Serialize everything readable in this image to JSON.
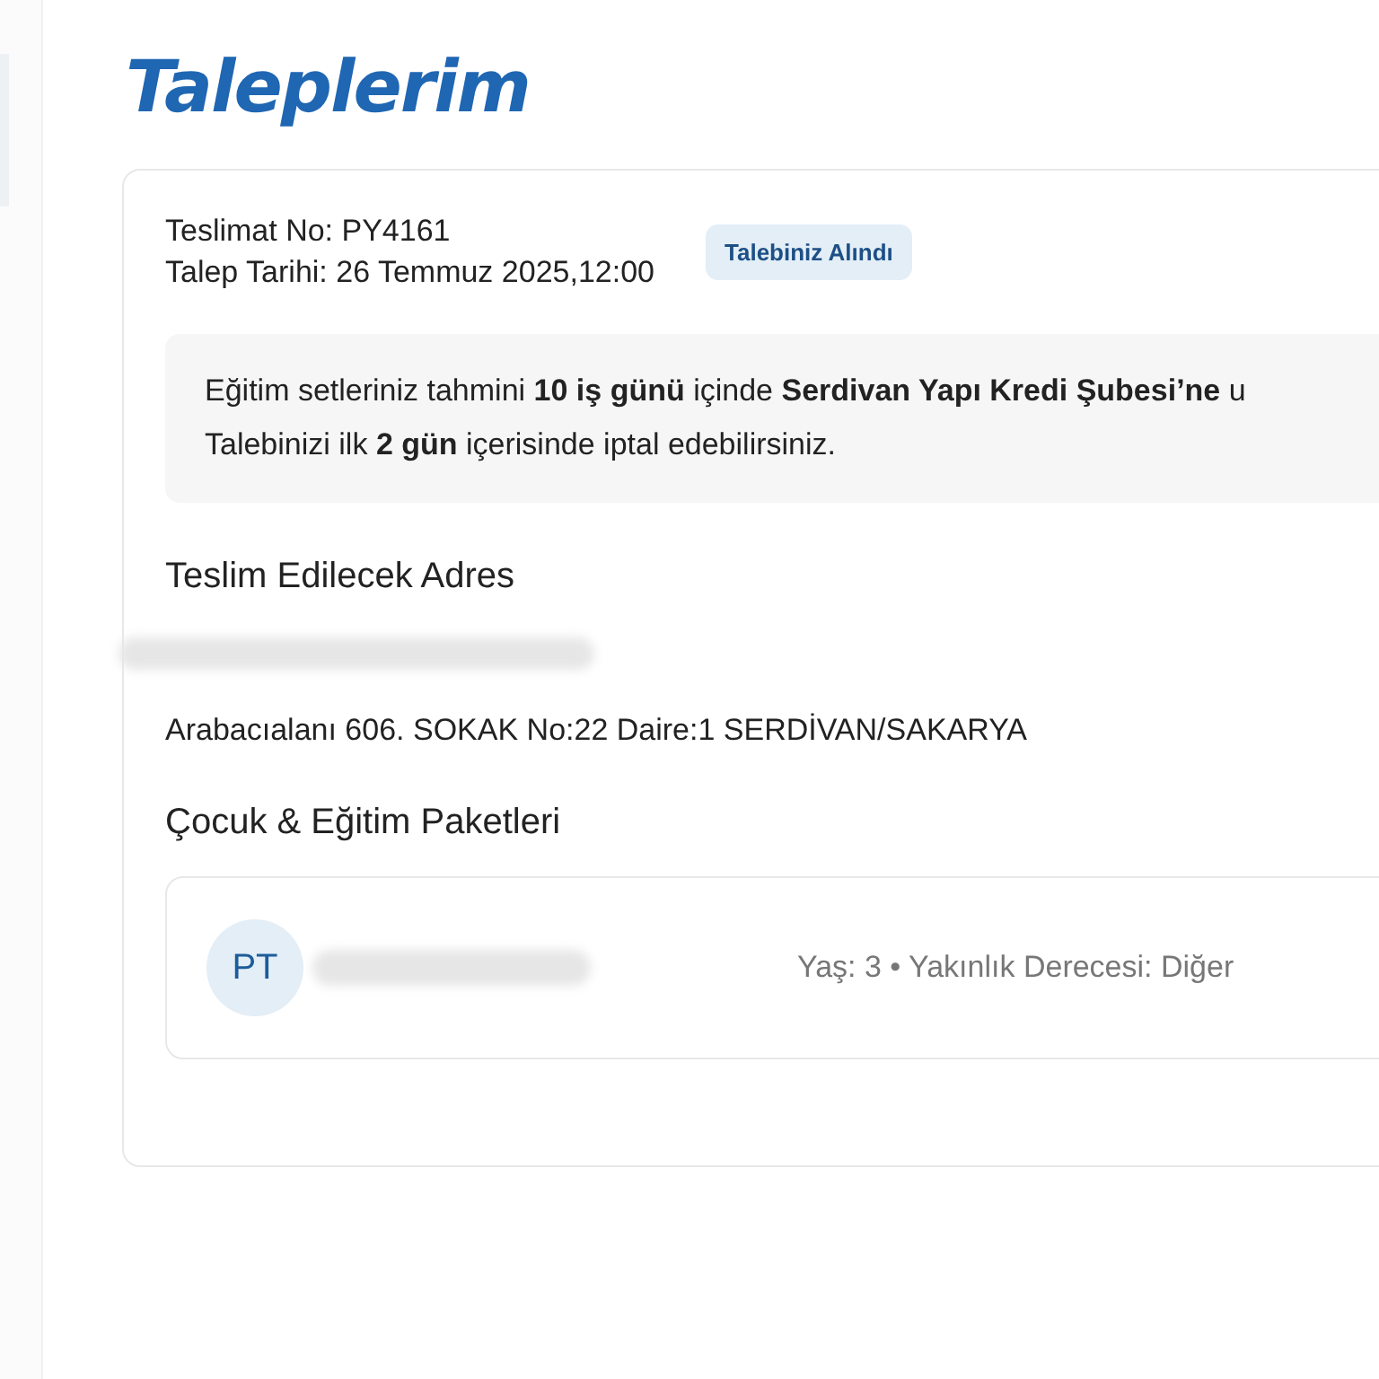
{
  "title": "Taleplerim",
  "request": {
    "delivery_no": "Teslimat No: PY4161",
    "request_date": "Talep Tarihi: 26 Temmuz 2025,12:00",
    "status_badge": "Talebiniz Alındı",
    "info_lines": [
      "Eğitim setleriniz tahmini **10 iş günü** içinde **Serdivan Yapı Kredi Şubesi’ne** u",
      "Talebinizi ilk **2 gün** içerisinde iptal edebilirsiniz."
    ],
    "address_heading": "Teslim Edilecek Adres",
    "address": "Arabacıalanı 606. SOKAK No:22 Daire:1 SERDİVAN/SAKARYA",
    "packages_heading": "Çocuk & Eğitim Paketleri",
    "children": [
      {
        "initials": "PT",
        "details": "Yaş: 3 • Yakınlık Derecesi: Diğer"
      }
    ]
  }
}
